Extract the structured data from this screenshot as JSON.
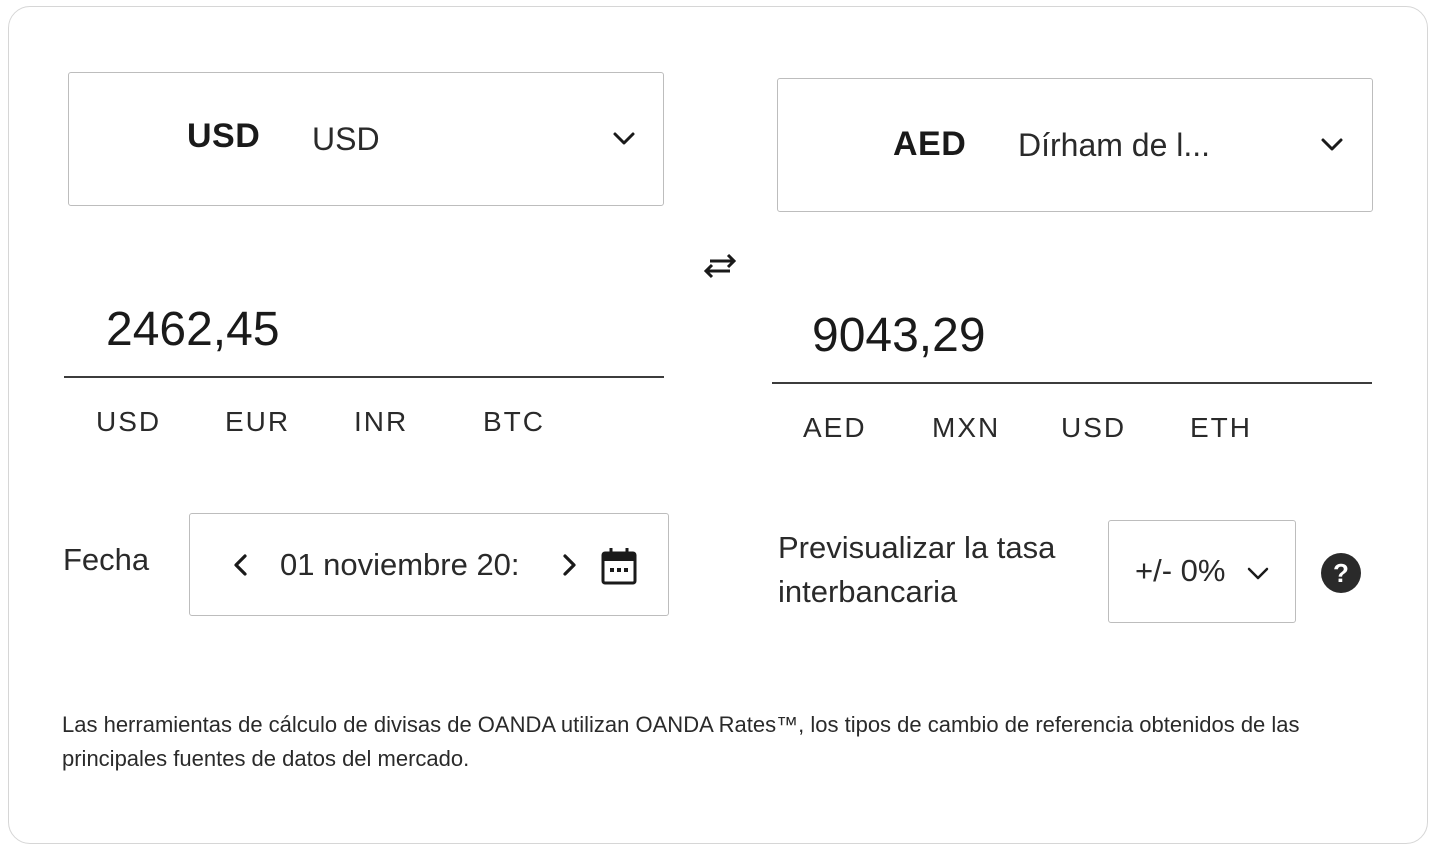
{
  "from": {
    "code": "USD",
    "name": "USD",
    "amount": "2462,45",
    "quick_currencies": [
      "USD",
      "EUR",
      "INR",
      "BTC"
    ]
  },
  "to": {
    "code": "AED",
    "name": "Dírham de l...",
    "amount": "9043,29",
    "quick_currencies": [
      "AED",
      "MXN",
      "USD",
      "ETH"
    ]
  },
  "date": {
    "label": "Fecha",
    "value": "01 noviembre 20:"
  },
  "interbank": {
    "label": "Previsualizar la tasa interbancaria",
    "rate": "+/- 0%"
  },
  "disclaimer": "Las herramientas de cálculo de divisas de OANDA utilizan OANDA Rates™, los tipos de cambio de referencia obtenidos de las principales fuentes de datos del mercado.",
  "icons": {
    "swap": "swap-arrows-icon",
    "dropdown": "chevron-down-icon",
    "prev": "chevron-left-icon",
    "next": "chevron-right-icon",
    "calendar": "calendar-icon",
    "help": "question-circle-icon"
  }
}
